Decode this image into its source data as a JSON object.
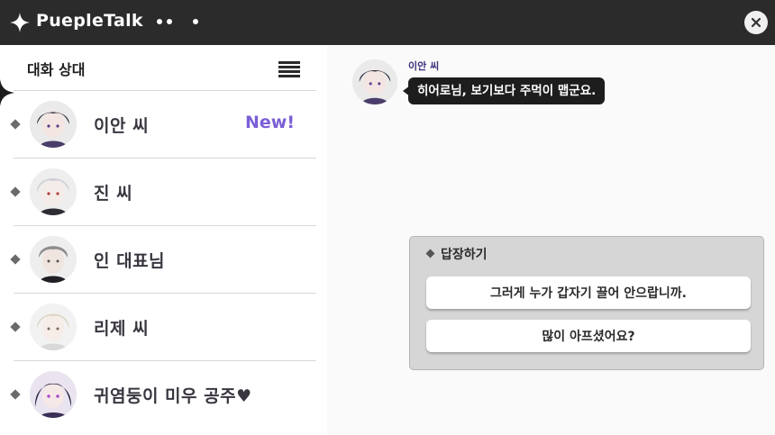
{
  "app": {
    "title": "PuepleTalk"
  },
  "sidebar": {
    "header": "대화 상대",
    "contacts": [
      {
        "name": "이안 씨",
        "badge": "New!"
      },
      {
        "name": "진 씨",
        "badge": ""
      },
      {
        "name": "인 대표님",
        "badge": ""
      },
      {
        "name": "리제 씨",
        "badge": ""
      },
      {
        "name": "귀염둥이 미우 공주♥",
        "badge": ""
      }
    ]
  },
  "chat": {
    "sender": "이안 씨",
    "message": "히어로님, 보기보다 주먹이 맵군요."
  },
  "reply": {
    "title": "답장하기",
    "options": [
      "그러게 누가 갑자기 끌어 안으랍니까.",
      "많이 아프셨어요?"
    ]
  },
  "icons": {
    "app": "sparkle-icon",
    "close": "close-icon",
    "menu": "hamburger-menu-icon"
  },
  "colors": {
    "titlebar": "#2b2b2b",
    "accent_new": "#7b5ed6",
    "bubble": "#1d1d1d"
  }
}
